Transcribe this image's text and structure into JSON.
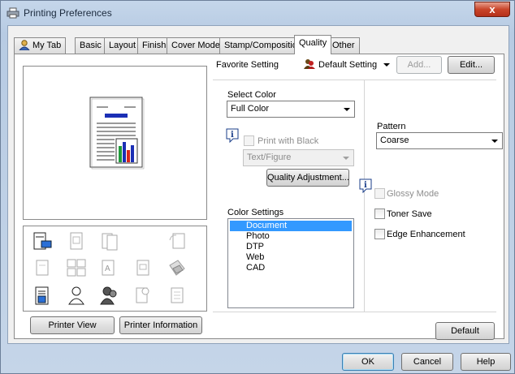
{
  "window": {
    "title": "Printing Preferences",
    "close_glyph": "x"
  },
  "tabs": [
    {
      "label": "My Tab",
      "active": false
    },
    {
      "label": "Basic",
      "active": false
    },
    {
      "label": "Layout",
      "active": false
    },
    {
      "label": "Finish",
      "active": false
    },
    {
      "label": "Cover Mode",
      "active": false
    },
    {
      "label": "Stamp/Composition",
      "active": false
    },
    {
      "label": "Quality",
      "active": true
    },
    {
      "label": "Other",
      "active": false
    }
  ],
  "favorite": {
    "label": "Favorite Setting",
    "value": "Default Setting",
    "add_label": "Add...",
    "edit_label": "Edit..."
  },
  "select_color": {
    "label": "Select Color",
    "value": "Full Color"
  },
  "print_with_black": {
    "label": "Print with Black",
    "checked": false,
    "enabled": false
  },
  "text_figure": {
    "value": "Text/Figure",
    "enabled": false
  },
  "quality_adjustment_label": "Quality Adjustment...",
  "color_settings": {
    "label": "Color Settings",
    "items": [
      "Document",
      "Photo",
      "DTP",
      "Web",
      "CAD"
    ],
    "selected": "Document"
  },
  "pattern": {
    "label": "Pattern",
    "value": "Coarse"
  },
  "glossy_mode": {
    "label": "Glossy Mode",
    "checked": false,
    "enabled": false
  },
  "toner_save": {
    "label": "Toner Save",
    "checked": false
  },
  "edge_enhancement": {
    "label": "Edge Enhancement",
    "checked": false
  },
  "buttons": {
    "printer_view": "Printer View",
    "printer_information": "Printer Information",
    "default": "Default",
    "ok": "OK",
    "cancel": "Cancel",
    "help": "Help"
  },
  "colors": {
    "selection": "#3399ff",
    "chart_blue": "#1b2fb5",
    "chart_green": "#1f9b3a",
    "chart_red": "#d8261c"
  }
}
